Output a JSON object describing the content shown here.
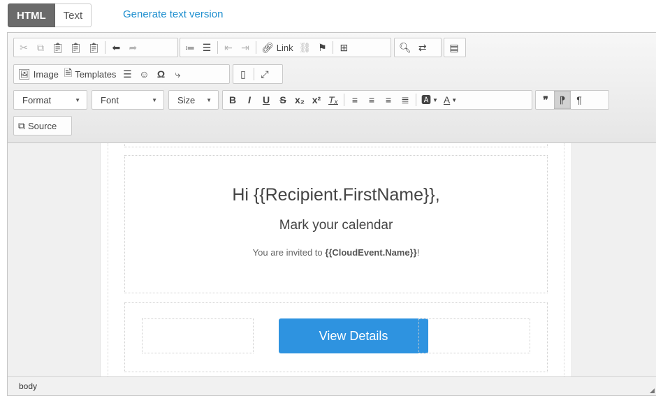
{
  "mode_tabs": {
    "html": "HTML",
    "text": "Text"
  },
  "generate_link": "Generate text version",
  "toolbar": {
    "row1": {
      "link": "Link"
    },
    "row2": {
      "image": "Image",
      "templates": "Templates"
    },
    "row3": {
      "format": "Format",
      "font": "Font",
      "size": "Size"
    },
    "row4": {
      "source": "Source"
    }
  },
  "content": {
    "greeting": "Hi {{Recipient.FirstName}},",
    "subheading": "Mark your calendar",
    "invite_prefix": "You are invited to ",
    "invite_event": "{{CloudEvent.Name}}",
    "invite_suffix": "!",
    "view_details": "View Details"
  },
  "statusbar": {
    "path": "body"
  },
  "colors": {
    "accent": "#2e93e0",
    "link": "#1f8fcf",
    "tab_active": "#6b6b6b"
  }
}
